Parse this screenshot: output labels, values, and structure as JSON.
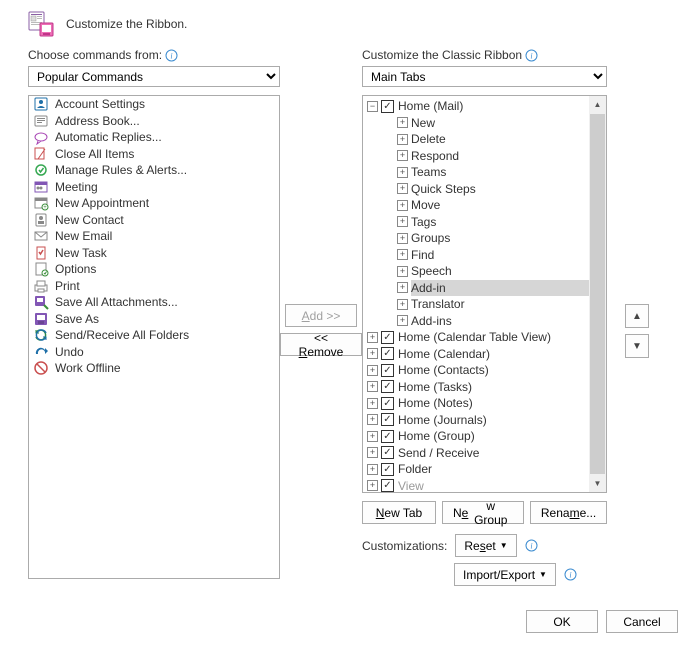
{
  "header": {
    "title": "Customize the Ribbon."
  },
  "left": {
    "label": "Choose commands from:",
    "combo": "Popular Commands",
    "items": [
      "Account Settings",
      "Address Book...",
      "Automatic Replies...",
      "Close All Items",
      "Manage Rules & Alerts...",
      "Meeting",
      "New Appointment",
      "New Contact",
      "New Email",
      "New Task",
      "Options",
      "Print",
      "Save All Attachments...",
      "Save As",
      "Send/Receive All Folders",
      "Undo",
      "Work Offline"
    ]
  },
  "mid": {
    "add": "Add >>",
    "remove": "<< Remove"
  },
  "right": {
    "label": "Customize the Classic Ribbon",
    "combo": "Main Tabs",
    "tree_root": "Home (Mail)",
    "subitems": [
      "New",
      "Delete",
      "Respond",
      "Teams",
      "Quick Steps",
      "Move",
      "Tags",
      "Groups",
      "Find",
      "Speech",
      "Add-in",
      "Translator",
      "Add-ins"
    ],
    "selected_sub": "Add-in",
    "tabs": [
      "Home (Calendar Table View)",
      "Home (Calendar)",
      "Home (Contacts)",
      "Home (Tasks)",
      "Home (Notes)",
      "Home (Journals)",
      "Home (Group)",
      "Send / Receive",
      "Folder",
      "View"
    ],
    "new_tab": "New Tab",
    "new_group": "New Group",
    "rename": "Rename...",
    "cust_label": "Customizations:",
    "reset": "Reset",
    "import_export": "Import/Export"
  },
  "footer": {
    "ok": "OK",
    "cancel": "Cancel"
  }
}
